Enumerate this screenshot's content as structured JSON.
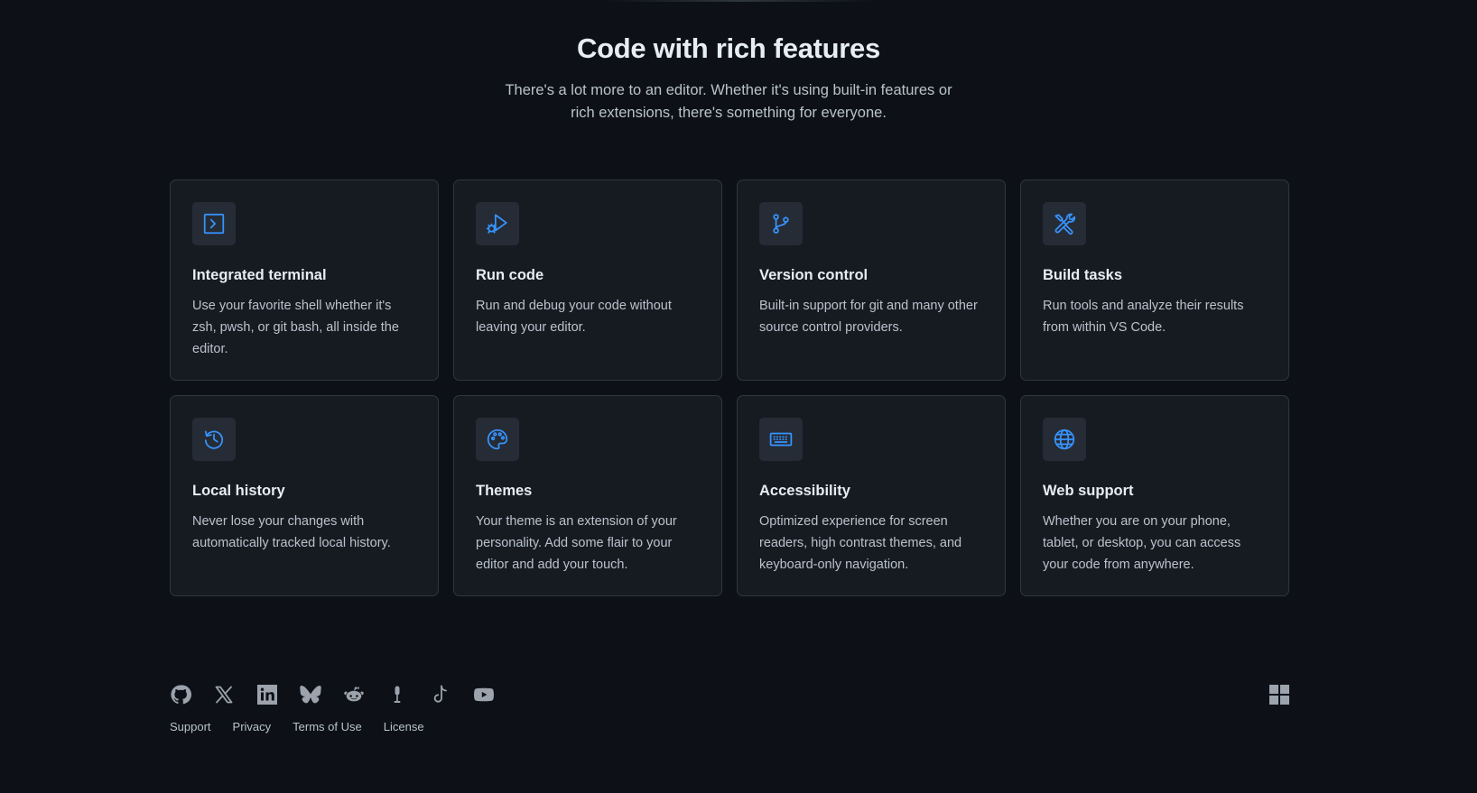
{
  "hero": {
    "title": "Code with rich features",
    "subtitle": "There's a lot more to an editor. Whether it's using built-in features or rich extensions, there's something for everyone."
  },
  "features": [
    {
      "icon": "terminal-icon",
      "title": "Integrated terminal",
      "desc": "Use your favorite shell whether it's zsh, pwsh, or git bash, all inside the editor."
    },
    {
      "icon": "run-debug-icon",
      "title": "Run code",
      "desc": "Run and debug your code without leaving your editor."
    },
    {
      "icon": "source-control-icon",
      "title": "Version control",
      "desc": "Built-in support for git and many other source control providers."
    },
    {
      "icon": "tools-icon",
      "title": "Build tasks",
      "desc": "Run tools and analyze their results from within VS Code."
    },
    {
      "icon": "history-icon",
      "title": "Local history",
      "desc": "Never lose your changes with automatically tracked local history."
    },
    {
      "icon": "palette-icon",
      "title": "Themes",
      "desc": "Your theme is an extension of your personality. Add some flair to your editor and add your touch."
    },
    {
      "icon": "keyboard-icon",
      "title": "Accessibility",
      "desc": "Optimized experience for screen readers, high contrast themes, and keyboard-only navigation."
    },
    {
      "icon": "globe-icon",
      "title": "Web support",
      "desc": "Whether you are on your phone, tablet, or desktop, you can access your code from anywhere."
    }
  ],
  "footer": {
    "social_icons": [
      "github-icon",
      "x-icon",
      "linkedin-icon",
      "bluesky-icon",
      "reddit-icon",
      "podcast-icon",
      "tiktok-icon",
      "youtube-icon"
    ],
    "links": [
      "Support",
      "Privacy",
      "Terms of Use",
      "License"
    ],
    "brand_icon": "microsoft-logo-icon"
  },
  "colors": {
    "background": "#0d1117",
    "card": "#161b22",
    "border": "#30363d",
    "accent": "#3794ff",
    "muted_icon": "#9ca3ad"
  }
}
